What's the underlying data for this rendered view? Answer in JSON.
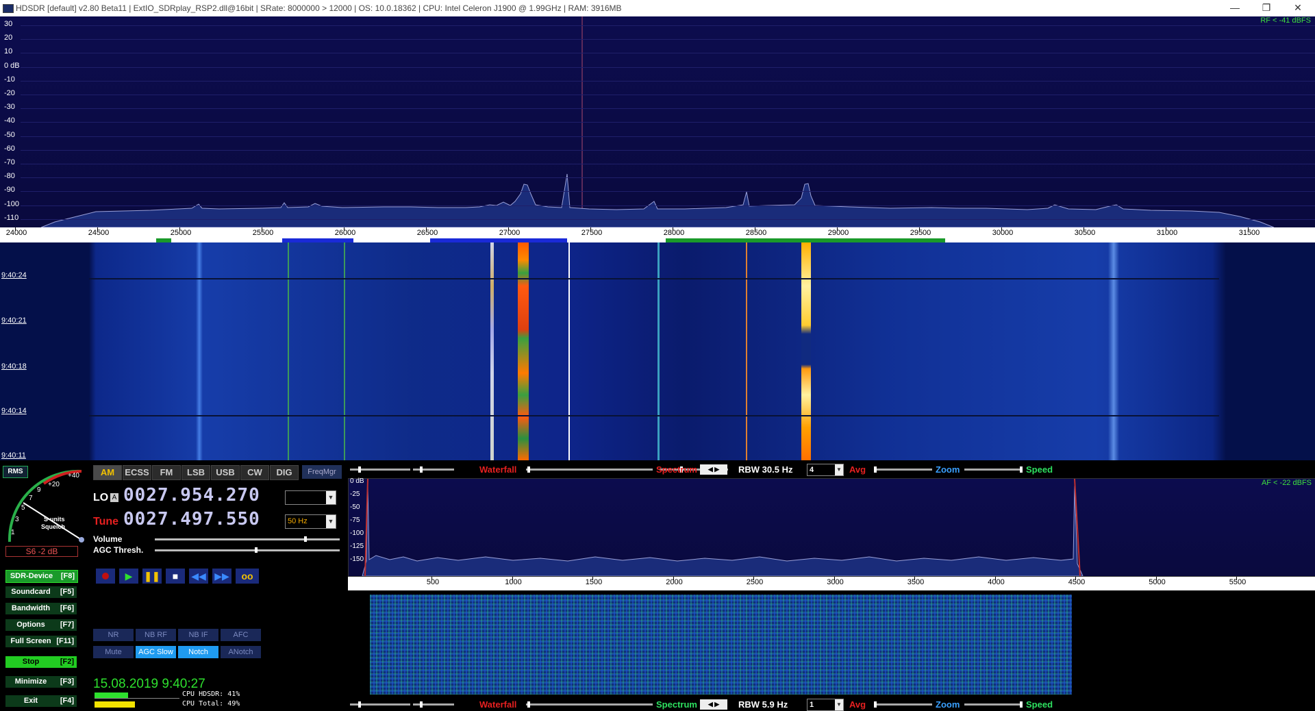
{
  "titlebar": {
    "text": "HDSDR  [default]  v2.80 Beta11  |  ExtIO_SDRplay_RSP2.dll@16bit  |  SRate: 8000000 > 12000  |  OS: 10.0.18362  |  CPU: Intel Celeron  J1900  @ 1.99GHz  |  RAM: 3916MB",
    "minimize": "—",
    "restore": "❐",
    "close": "✕"
  },
  "rf_spectrum": {
    "db_ticks": [
      "30",
      "20",
      "10",
      "0 dB",
      "-10",
      "-20",
      "-30",
      "-40",
      "-50",
      "-60",
      "-70",
      "-80",
      "-90",
      "-100",
      "-110"
    ],
    "indicator": "RF < -41 dBFS",
    "freq_ticks": [
      "24000",
      "24500",
      "25000",
      "25500",
      "26000",
      "26500",
      "27000",
      "27500",
      "28000",
      "28500",
      "29000",
      "29500",
      "30000",
      "30500",
      "31000",
      "31500"
    ]
  },
  "rf_waterfall": {
    "timestamps": [
      "9:40:24",
      "9:40:21",
      "9:40:18",
      "9:40:14",
      "9:40:11"
    ]
  },
  "smeter": {
    "rms": "RMS",
    "scale": [
      "1",
      "3",
      "5",
      "7",
      "9",
      "+20",
      "+40"
    ],
    "smeter_label": "S-units",
    "squelch_label": "Squelch",
    "reading": "S6 -2 dB"
  },
  "left_buttons": [
    {
      "label": "SDR-Device",
      "key": "[F8]"
    },
    {
      "label": "Soundcard",
      "key": "[F5]"
    },
    {
      "label": "Bandwidth",
      "key": "[F6]"
    },
    {
      "label": "Options",
      "key": "[F7]"
    },
    {
      "label": "Full Screen",
      "key": "[F11]"
    },
    {
      "label": "Stop",
      "key": "[F2]"
    },
    {
      "label": "Minimize",
      "key": "[F3]"
    },
    {
      "label": "Exit",
      "key": "[F4]"
    }
  ],
  "modes": [
    "AM",
    "ECSS",
    "FM",
    "LSB",
    "USB",
    "CW",
    "DIG"
  ],
  "selected_mode": "AM",
  "freqmgr": "FreqMgr",
  "lo": {
    "label": "LO",
    "badge": "A",
    "value": "0027.954.270",
    "dropdown": ""
  },
  "tune": {
    "label": "Tune",
    "value": "0027.497.550",
    "step": "50 Hz"
  },
  "volume": {
    "label": "Volume",
    "level": 0.82
  },
  "agc_thresh": {
    "label": "AGC Thresh.",
    "level": 0.55
  },
  "transport": [
    "record",
    "play",
    "pause",
    "stop",
    "rewind",
    "fast-forward",
    "loop"
  ],
  "filters_row1": [
    "NR",
    "NB RF",
    "NB IF",
    "AFC"
  ],
  "filters_row2": [
    "Mute",
    "AGC Slow",
    "Notch",
    "ANotch"
  ],
  "filters_active": [
    "AGC Slow",
    "Notch"
  ],
  "datetime": "15.08.2019 9:40:27",
  "cpu": {
    "hdsdr": "CPU HDSDR: 41%",
    "hdsdr_pct": 41,
    "total": "CPU Total: 49%",
    "total_pct": 49
  },
  "rf_ctrl": {
    "waterfall": "Waterfall",
    "spectrum": "Spectrum",
    "rbw": "RBW 30.5 Hz",
    "avg_value": "4",
    "avg": "Avg",
    "zoom": "Zoom",
    "speed": "Speed"
  },
  "af_ctrl": {
    "waterfall": "Waterfall",
    "spectrum": "Spectrum",
    "rbw": "RBW  5.9 Hz",
    "avg_value": "1",
    "avg": "Avg",
    "zoom": "Zoom",
    "speed": "Speed"
  },
  "af_spectrum": {
    "db_ticks": [
      "0 dB",
      "-25",
      "-50",
      "-75",
      "-100",
      "-125",
      "-150"
    ],
    "indicator": "AF < -22 dBFS",
    "freq_ticks": [
      "500",
      "1000",
      "1500",
      "2000",
      "2500",
      "3000",
      "3500",
      "4000",
      "4500",
      "5000",
      "5500"
    ]
  },
  "colors": {
    "spectrum_bg": "#0c0c4e",
    "waterfall_bg": "#04104a",
    "green_button": "#22cc22",
    "accent_red": "#e62020",
    "accent_green": "#22dd55",
    "digits": "#c8c8f0"
  }
}
